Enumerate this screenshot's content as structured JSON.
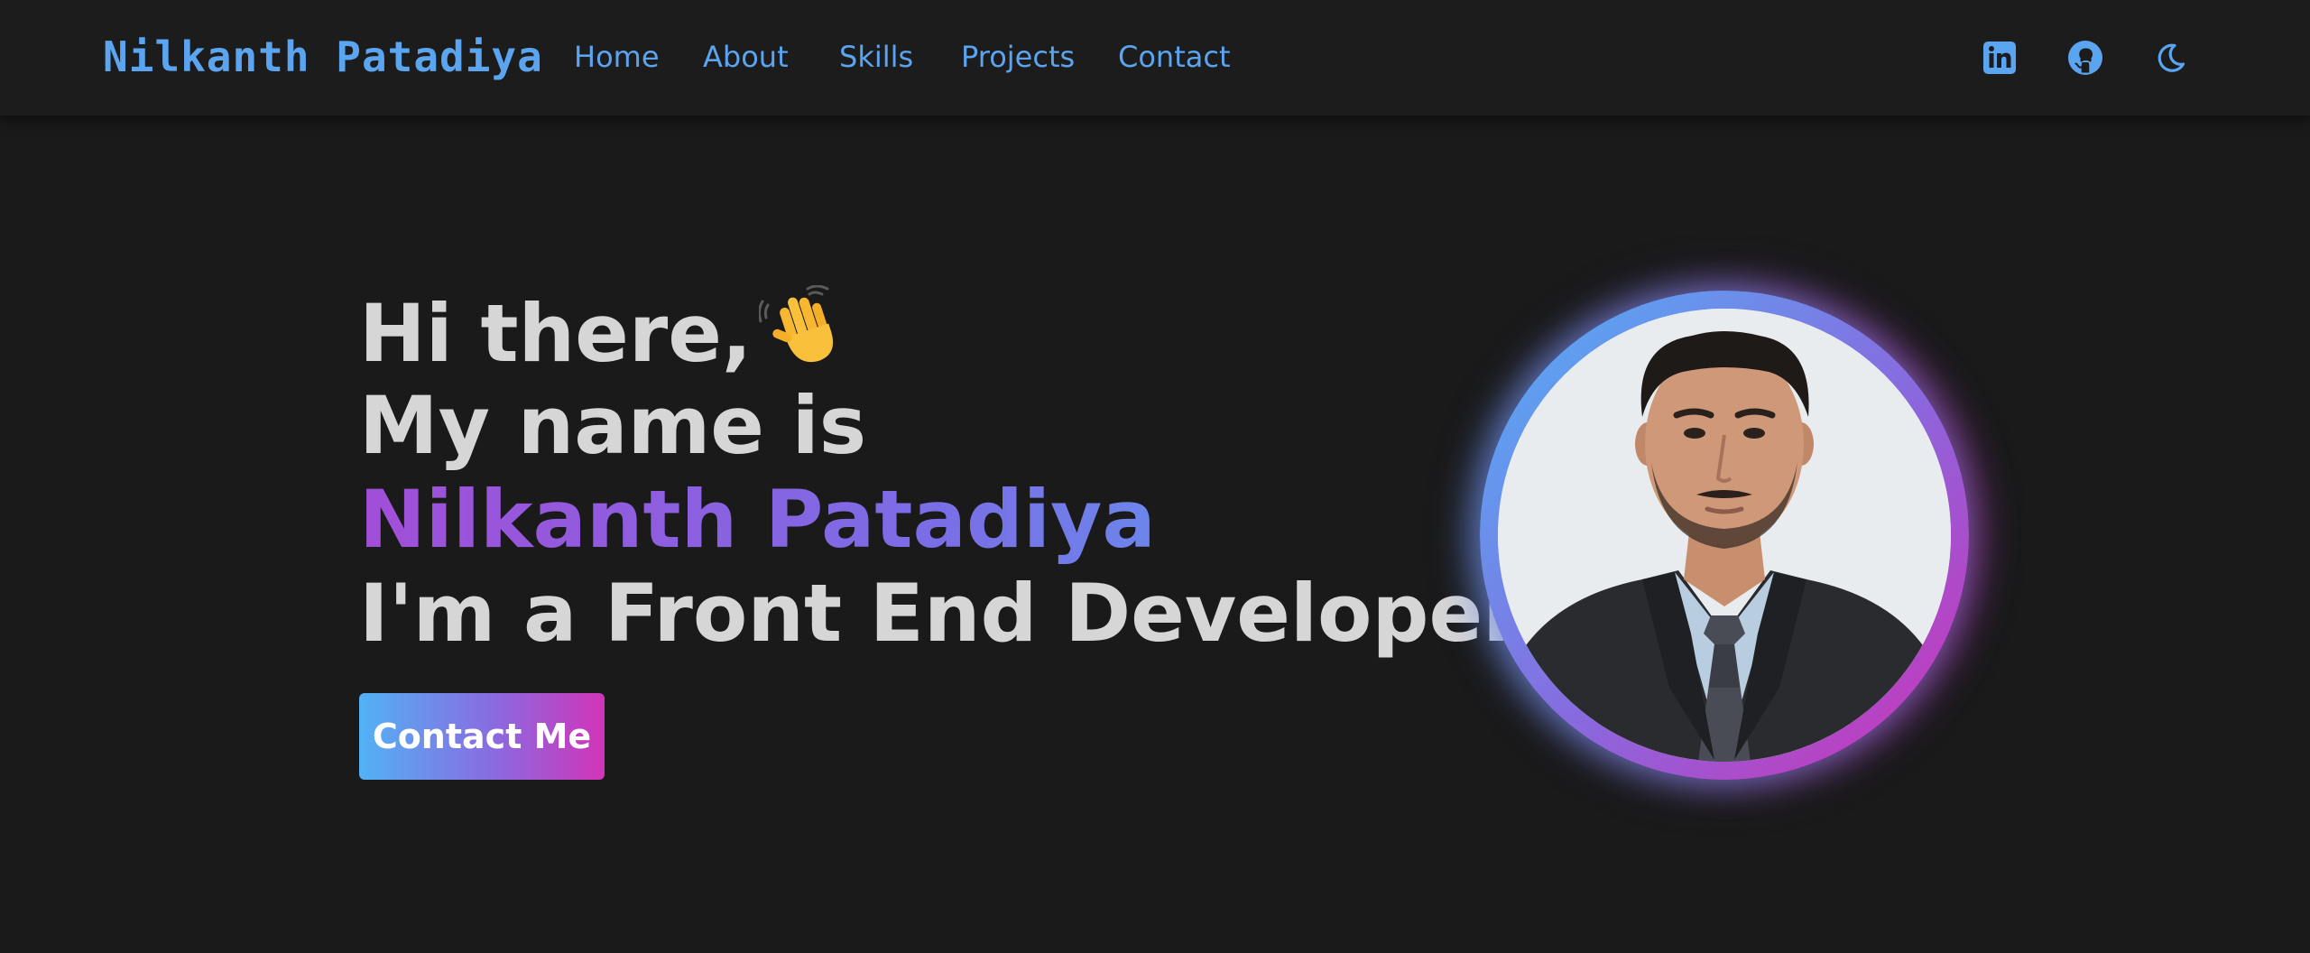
{
  "brand": {
    "name": "Nilkanth Patadiya",
    "color": "#5aa4f0"
  },
  "nav": {
    "links": [
      {
        "label": "Home"
      },
      {
        "label": "About"
      },
      {
        "label": "Skills"
      },
      {
        "label": "Projects"
      },
      {
        "label": "Contact"
      }
    ],
    "icons": [
      "linkedin-icon",
      "github-icon",
      "moon-icon"
    ]
  },
  "hero": {
    "greeting": "Hi there,",
    "greeting_emoji": "waving-hand-icon",
    "intro": "My name is",
    "name": "Nilkanth Patadiya",
    "role": "I'm a Front End Developer",
    "cta_label": "Contact Me"
  },
  "colors": {
    "background": "#1a1a1a",
    "navbar": "#1c1c1c",
    "accent_blue": "#5aa4f0",
    "gradient_start": "#52b2f5",
    "gradient_end": "#d234b8",
    "text": "#d6d6d6"
  }
}
